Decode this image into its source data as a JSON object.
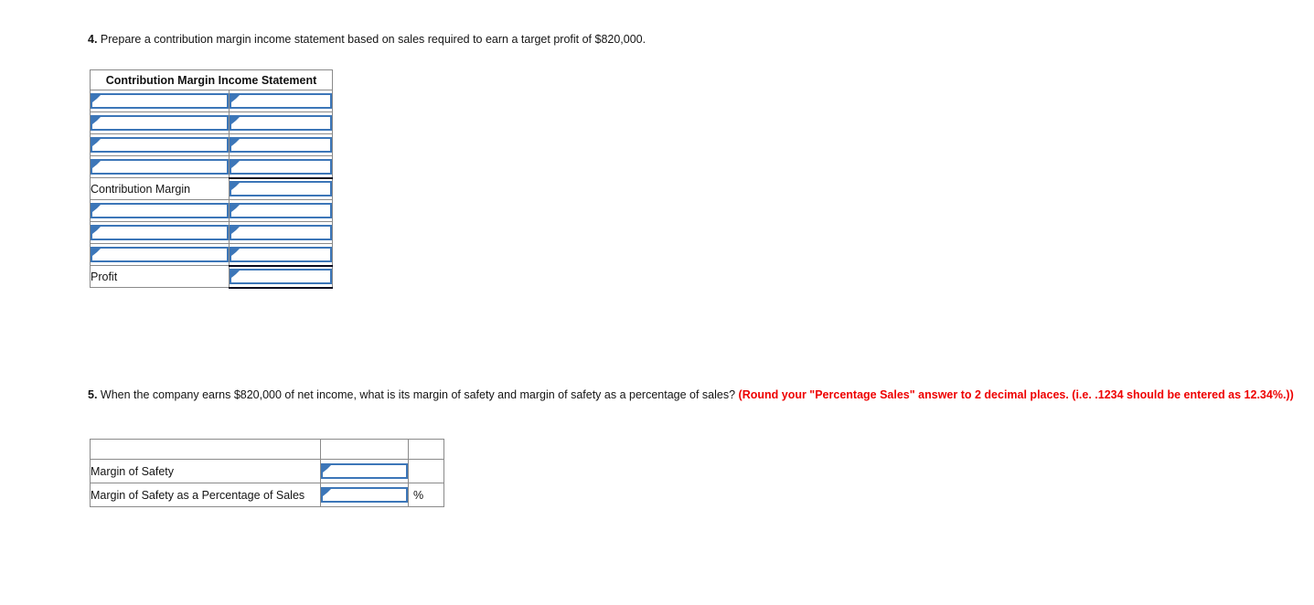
{
  "questions": {
    "q4": {
      "number": "4.",
      "text": " Prepare a contribution margin income statement based on sales required to earn a target profit of $820,000."
    },
    "q5": {
      "number": "5.",
      "text": " When the company earns $820,000 of net income, what is its margin of safety and margin of safety as a percentage of sales? ",
      "note": "(Round your \"Percentage Sales\" answer to 2 decimal places. (i.e. .1234 should be entered as 12.34%.))"
    }
  },
  "contribution_margin_table": {
    "header": "Contribution Margin Income Statement",
    "rows": [
      {
        "label": "",
        "label_editable": true,
        "label_value": "",
        "value": "",
        "rule_top": false,
        "rule_bottom": false
      },
      {
        "label": "",
        "label_editable": true,
        "label_value": "",
        "value": "",
        "rule_top": false,
        "rule_bottom": false
      },
      {
        "label": "",
        "label_editable": true,
        "label_value": "",
        "value": "",
        "rule_top": false,
        "rule_bottom": false
      },
      {
        "label": "",
        "label_editable": true,
        "label_value": "",
        "value": "",
        "rule_top": false,
        "rule_bottom": false
      },
      {
        "label": "Contribution Margin",
        "label_editable": false,
        "label_value": "",
        "value": "",
        "rule_top": true,
        "rule_bottom": false
      },
      {
        "label": "",
        "label_editable": true,
        "label_value": "",
        "value": "",
        "rule_top": false,
        "rule_bottom": false
      },
      {
        "label": "",
        "label_editable": true,
        "label_value": "",
        "value": "",
        "rule_top": false,
        "rule_bottom": false
      },
      {
        "label": "",
        "label_editable": true,
        "label_value": "",
        "value": "",
        "rule_top": false,
        "rule_bottom": false
      },
      {
        "label": "Profit",
        "label_editable": false,
        "label_value": "",
        "value": "",
        "rule_top": true,
        "rule_bottom": true
      }
    ]
  },
  "margin_of_safety_table": {
    "header_cells": [
      "",
      "",
      ""
    ],
    "rows": [
      {
        "label": "Margin of Safety",
        "value": "",
        "suffix": ""
      },
      {
        "label": "Margin of Safety as a Percentage of Sales",
        "value": "",
        "suffix": "%"
      }
    ]
  },
  "colors": {
    "header_blue": "#6ca6e8",
    "input_border_blue": "#3c76b8",
    "grid_grey": "#8a8a8a",
    "note_red": "#ee0000",
    "total_rule": "#0a0a1e"
  }
}
